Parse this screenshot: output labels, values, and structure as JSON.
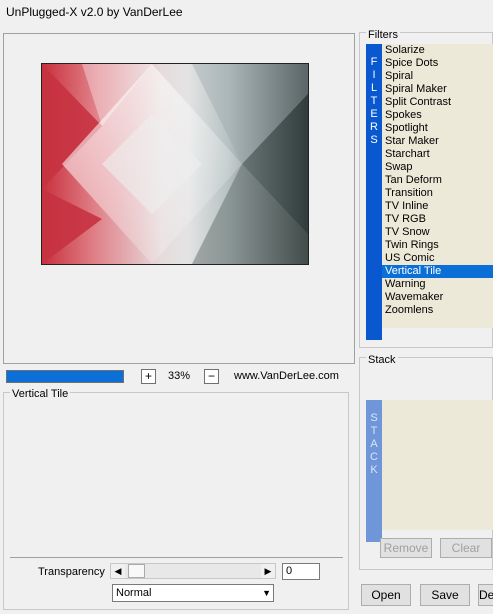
{
  "window": {
    "title": "UnPlugged-X v2.0 by VanDerLee"
  },
  "preview": {
    "zoom": "33%",
    "zoom_in": "+",
    "zoom_out": "−",
    "website": "www.VanDerLee.com",
    "progress": 1.0
  },
  "settings": {
    "title": "Vertical Tile",
    "transparency_label": "Transparency",
    "transparency_value": "0",
    "blend_mode": "Normal",
    "slider_left": "◀",
    "slider_right": "▶",
    "dropdown_arrow": "▼"
  },
  "filters": {
    "label": "Filters",
    "bar_letters": [
      "F",
      "I",
      "L",
      "T",
      "E",
      "R",
      "S"
    ],
    "items": [
      "Solarize",
      "Spice Dots",
      "Spiral",
      "Spiral Maker",
      "Split Contrast",
      "Spokes",
      "Spotlight",
      "Star Maker",
      "Starchart",
      "Swap",
      "Tan Deform",
      "Transition",
      "TV Inline",
      "TV RGB",
      "TV Snow",
      "Twin Rings",
      "US Comic",
      "Vertical Tile",
      "Warning",
      "Wavemaker",
      "Zoomlens"
    ],
    "selected": "Vertical Tile"
  },
  "stack": {
    "label": "Stack",
    "bar_letters": [
      "S",
      "T",
      "A",
      "C",
      "K"
    ],
    "remove_label": "Remove",
    "clear_label": "Clear"
  },
  "actions": {
    "open_label": "Open",
    "save_label": "Save",
    "third_label": "Default"
  },
  "colors": {
    "accent": "#0a6fd6",
    "filter_bar": "#0a58d0",
    "list_bg": "#ece9d8"
  }
}
